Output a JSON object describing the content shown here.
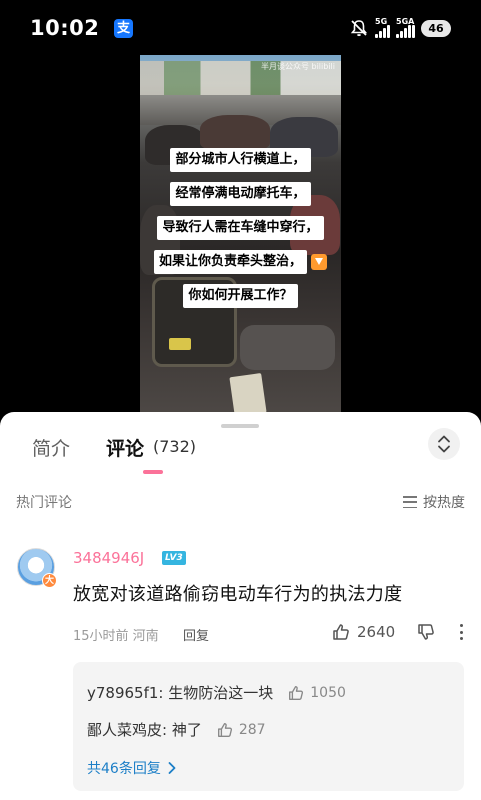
{
  "status_bar": {
    "time": "10:02",
    "network_1": "5G",
    "network_2": "5GA",
    "battery": "46",
    "app_icon": "alipay-icon"
  },
  "video": {
    "watermark": "半月谈公众号 bilibili",
    "captions": [
      "部分城市人行横道上，",
      "经常停满电动摩托车，",
      "导致行人需在车缝中穿行，",
      "如果让你负责牵头整治，",
      "你如何开展工作？"
    ]
  },
  "tabs": {
    "intro": "简介",
    "comments": "评论",
    "comments_count": "(732)"
  },
  "comments_header": {
    "title": "热门评论",
    "sort_label": "按热度"
  },
  "comment": {
    "username": "3484946J",
    "level": "LV3",
    "avatar_badge": "大",
    "text": "放宽对该道路偷窃电动车行为的执法力度",
    "meta": "15小时前  河南",
    "reply_label": "回复",
    "likes": "2640",
    "replies": [
      {
        "author": "y78965f1",
        "text": "生物防治这一块",
        "likes": "1050"
      },
      {
        "author": "鄙人菜鸡皮",
        "text": "神了",
        "likes": "287"
      }
    ],
    "more_replies": "共46条回复"
  },
  "colors": {
    "accent_pink": "#fb7299",
    "link_blue": "#1d7fc7"
  }
}
